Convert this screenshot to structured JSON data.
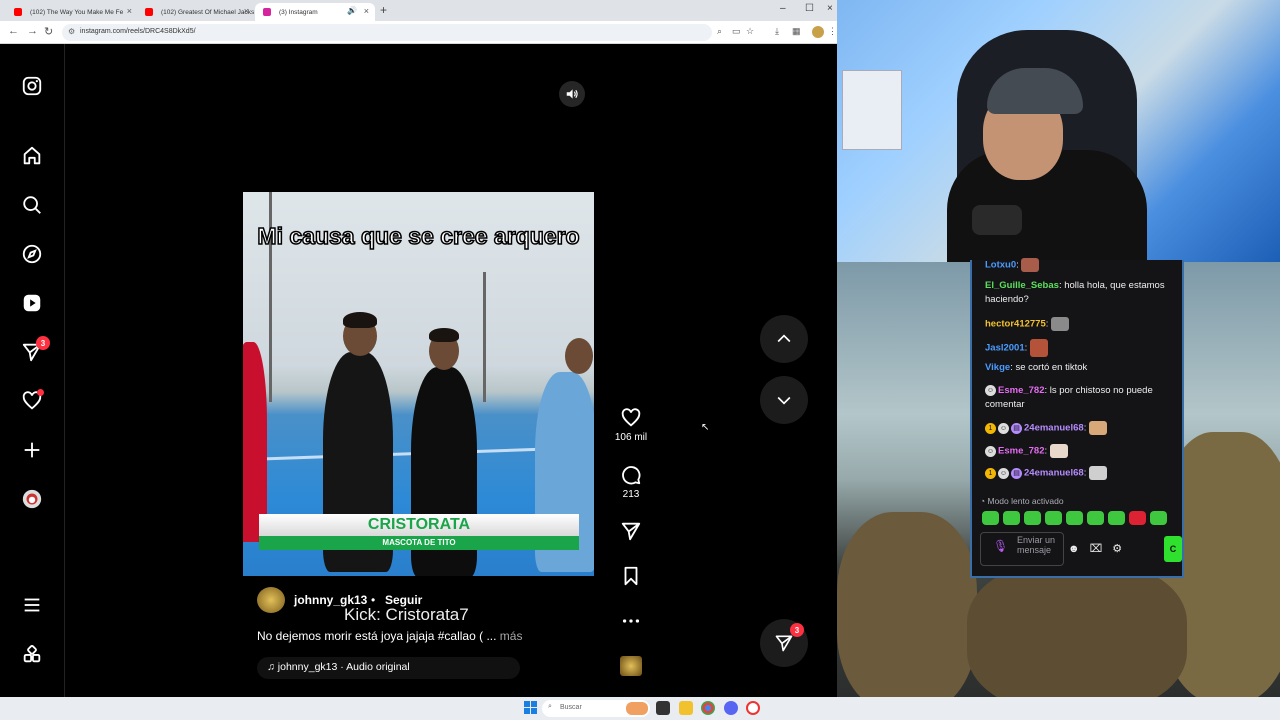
{
  "browser": {
    "tabs": [
      {
        "title": "(102) The Way You Make Me Fe",
        "favicon_color": "#ff0000",
        "active": false
      },
      {
        "title": "(102) Greatest Of Michael Jacks",
        "favicon_color": "#ff0000",
        "active": false
      },
      {
        "title": "(3) Instagram",
        "favicon_color": "#d6249f",
        "active": true
      }
    ],
    "new_tab_symbol": "+",
    "url": "instagram.com/reels/DRC4S8DkXd5/"
  },
  "instagram": {
    "nav": [
      {
        "name": "instagram-logo-icon"
      },
      {
        "name": "home-icon"
      },
      {
        "name": "search-icon"
      },
      {
        "name": "explore-icon"
      },
      {
        "name": "reels-icon"
      },
      {
        "name": "messages-icon",
        "badge": "3"
      },
      {
        "name": "notifications-icon"
      },
      {
        "name": "create-icon"
      },
      {
        "name": "profile-avatar"
      },
      {
        "name": "menu-icon"
      },
      {
        "name": "also-from-meta-icon"
      }
    ],
    "reel": {
      "caption_overlay": "Mi causa que se cree arquero",
      "lower_third_title": "CRISTORATA",
      "lower_third_subtitle": "MASCOTA DE TITO",
      "username": "johnny_gk13",
      "bullet": "•",
      "follow_label": "Seguir",
      "description": "No dejemos morir está joya jajaja #callao",
      "description_suffix": " ( ... ",
      "more_label": "más",
      "audio_label": "johnny_gk13 · Audio original"
    },
    "actions": {
      "likes": "106 mil",
      "comments": "213"
    },
    "messages_fab_badge": "3"
  },
  "stream": {
    "overlay_text": "Kick: Cristorata7",
    "chat": [
      {
        "user": "Lotxu0",
        "color": "#4a9cff",
        "text": "",
        "emote": true
      },
      {
        "user": "El_Guille_Sebas",
        "color": "#5ce05c",
        "text": "holla hola, que estamos haciendo?"
      },
      {
        "user": "hector412775",
        "color": "#f2c12e",
        "text": "",
        "emote": true
      },
      {
        "user": "Jasl2001",
        "color": "#4a9cff",
        "text": "",
        "emote": true
      },
      {
        "user": "Vikge",
        "color": "#4a9cff",
        "text": "se cortó en tiktok"
      },
      {
        "user": "Esme_782",
        "color": "#e36cf0",
        "text": "ls por chistoso no puede comentar"
      },
      {
        "user": "24emanuel68",
        "color": "#b58cff",
        "text": "",
        "emote": true
      },
      {
        "user": "Esme_782",
        "color": "#e36cf0",
        "text": "",
        "emote": true
      },
      {
        "user": "24emanuel68",
        "color": "#b58cff",
        "text": "",
        "emote": true
      }
    ],
    "slow_mode": "Modo lento activado",
    "input_placeholder": "Enviar un mensaje",
    "send_label": "C"
  },
  "taskbar": {
    "search_placeholder": "Buscar"
  }
}
